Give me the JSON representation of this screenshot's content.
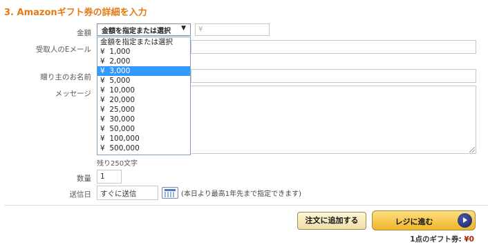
{
  "section_title": "3. Amazonギフト券の詳細を入力",
  "labels": {
    "amount": "金額",
    "recipient_email": "受取人のEメール",
    "sender_name": "贈り主のお名前",
    "message": "メッセージ",
    "quantity": "数量",
    "send_date": "送信日"
  },
  "amount_select": {
    "selected": "金額を指定または選択",
    "arrow": "▼",
    "custom_placeholder": "¥",
    "options": [
      "金額を指定または選択",
      "¥  1,000",
      "¥  2,000",
      "¥  3,000",
      "¥  5,000",
      "¥  10,000",
      "¥  20,000",
      "¥  25,000",
      "¥  30,000",
      "¥  50,000",
      "¥  100,000",
      "¥  500,000"
    ],
    "highlighted_index": 3
  },
  "message_remaining": "残り250文字",
  "quantity_value": "1",
  "send_date_value": "すぐに送信",
  "send_date_hint": "(本日より最高1年先まで指定できます)",
  "buttons": {
    "add_to_cart": "注文に追加する",
    "proceed_to_checkout": "レジに進む"
  },
  "summary": {
    "label": "1点のギフト券:",
    "price": "¥0"
  },
  "colors": {
    "title": "#e47911",
    "highlight": "#3399ff",
    "price": "#b12704"
  }
}
